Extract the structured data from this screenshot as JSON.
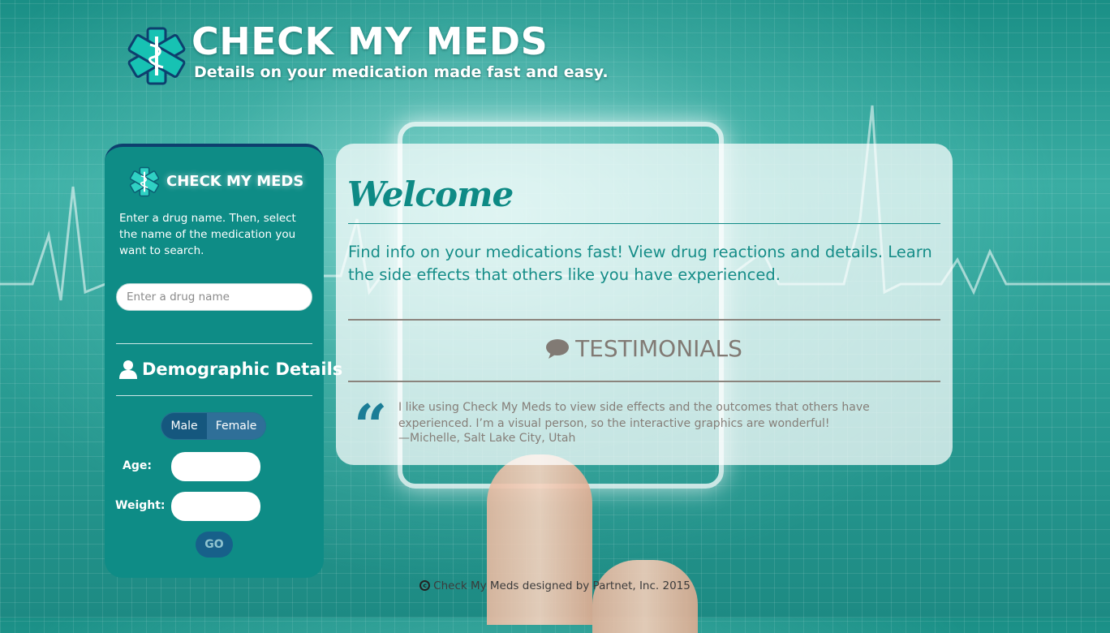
{
  "header": {
    "title": "CHECK MY MEDS",
    "tagline": "Details on your medication made fast and easy."
  },
  "sidebar": {
    "brand": "CHECK MY MEDS",
    "intro": "Enter a drug name. Then, select the name of the medication you want to search.",
    "drug_input": {
      "placeholder": "Enter a drug name",
      "value": ""
    },
    "demographics_title": "Demographic Details",
    "gender": {
      "options": [
        "Male",
        "Female"
      ]
    },
    "age_label": "Age:",
    "weight_label": "Weight:",
    "go_label": "GO"
  },
  "main": {
    "welcome_title": "Welcome",
    "intro": "Find info on your medications fast! View drug reactions and details. Learn the side effects that others like you have experienced.",
    "testimonials_title": "TESTIMONIALS",
    "testimonial": {
      "quote_mark": "“",
      "text": "I like using Check My Meds to view side effects and the outcomes that others have experienced. I’m a visual person, so the interactive graphics are wonderful!",
      "author": "—Michelle, Salt Lake City, Utah"
    }
  },
  "footer": {
    "copyright_symbol": "c",
    "text": "Check My Meds designed by Partnet, Inc. 2015"
  },
  "colors": {
    "teal": "#0e8c86",
    "navy": "#15577e",
    "testimonial_gray": "#817a74"
  },
  "icons": [
    "star-of-life-logo-icon",
    "user-icon",
    "speech-bubble-icon",
    "copyright-icon"
  ]
}
